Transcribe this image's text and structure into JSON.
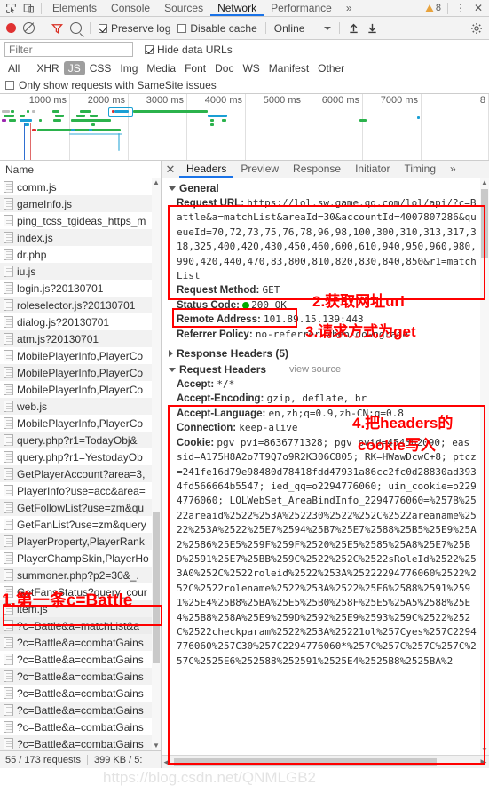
{
  "devtools": {
    "icons": [
      "inspect-element-icon",
      "device-toolbar-icon"
    ],
    "tabs": [
      {
        "label": "Elements",
        "active": false
      },
      {
        "label": "Console",
        "active": false
      },
      {
        "label": "Sources",
        "active": false
      },
      {
        "label": "Network",
        "active": true
      },
      {
        "label": "Performance",
        "active": false
      }
    ],
    "more_tabs": "»",
    "warning_count": "8",
    "menu_glyph": "⋮",
    "close_glyph": "✕"
  },
  "network_toolbar": {
    "record_title": "record-button",
    "clear_title": "clear-button",
    "filter_title": "filter-button",
    "search_title": "search-button",
    "preserve_log": "Preserve log",
    "preserve_log_checked": true,
    "disable_cache": "Disable cache",
    "disable_cache_checked": false,
    "throttle_value": "Online",
    "import_title": "import-har-button",
    "export_title": "export-har-button",
    "settings_title": "settings-gear"
  },
  "filter_bar": {
    "filter_placeholder": "Filter",
    "filter_value": "",
    "hide_data_urls": "Hide data URLs",
    "hide_data_urls_checked": true,
    "types": [
      {
        "label": "All",
        "selected": false
      },
      {
        "label": "XHR",
        "selected": false
      },
      {
        "label": "JS",
        "selected": true
      },
      {
        "label": "CSS",
        "selected": false
      },
      {
        "label": "Img",
        "selected": false
      },
      {
        "label": "Media",
        "selected": false
      },
      {
        "label": "Font",
        "selected": false
      },
      {
        "label": "Doc",
        "selected": false
      },
      {
        "label": "WS",
        "selected": false
      },
      {
        "label": "Manifest",
        "selected": false
      },
      {
        "label": "Other",
        "selected": false
      }
    ],
    "samesite_label": "Only show requests with SameSite issues",
    "samesite_checked": false
  },
  "overview": {
    "ticks": [
      "1000 ms",
      "2000 ms",
      "3000 ms",
      "4000 ms",
      "5000 ms",
      "6000 ms",
      "7000 ms",
      "8"
    ]
  },
  "request_list": {
    "column_header": "Name",
    "rows": [
      "comm.js",
      "gameInfo.js",
      "ping_tcss_tgideas_https_m",
      "index.js",
      "dr.php",
      "iu.js",
      "login.js?20130701",
      "roleselector.js?20130701",
      "dialog.js?20130701",
      "atm.js?20130701",
      "MobilePlayerInfo,PlayerCo",
      "MobilePlayerInfo,PlayerCo",
      "MobilePlayerInfo,PlayerCo",
      "web.js",
      "MobilePlayerInfo,PlayerCo",
      "query.php?r1=TodayObj&",
      "query.php?r1=YestodayOb",
      "GetPlayerAccount?area=3,",
      "PlayerInfo?use=acc&area=",
      "GetFollowList?use=zm&qu",
      "GetFanList?use=zm&query",
      "PlayerProperty,PlayerRank",
      "PlayerChampSkin,PlayerHo",
      "summoner.php?p2=30&_.",
      "GetFansStatus?query_cour",
      "item.js",
      "?c=Battle&a=matchList&a",
      "?c=Battle&a=combatGains",
      "?c=Battle&a=combatGains",
      "?c=Battle&a=combatGains",
      "?c=Battle&a=combatGains",
      "?c=Battle&a=combatGains",
      "?c=Battle&a=combatGains",
      "?c=Battle&a=combatGains",
      "?c=Battle&a=combatGains",
      "?c=Battle&a=combatGains"
    ],
    "selected_index": 26,
    "status_requests": "55 / 173 requests",
    "status_transferred": "399 KB / 5:"
  },
  "details": {
    "tabs": [
      {
        "label": "Headers",
        "active": true
      },
      {
        "label": "Preview",
        "active": false
      },
      {
        "label": "Response",
        "active": false
      },
      {
        "label": "Initiator",
        "active": false
      },
      {
        "label": "Timing",
        "active": false
      }
    ],
    "more_glyph": "»",
    "close_glyph": "✕",
    "general_title": "General",
    "general": [
      {
        "key": "Request URL:",
        "value": "https://lol.sw.game.qq.com/lol/api/?c=Battle&a=matchList&areaId=30&accountId=4007807286&queueId=70,72,73,75,76,78,96,98,100,300,310,313,317,318,325,400,420,430,450,460,600,610,940,950,960,980,990,420,440,470,83,800,810,820,830,840,850&r1=matchList"
      },
      {
        "key": "Request Method:",
        "value": "GET"
      },
      {
        "key": "Status Code:",
        "value": "200 OK",
        "dot": true
      },
      {
        "key": "Remote Address:",
        "value": "101.89.15.139:443"
      },
      {
        "key": "Referrer Policy:",
        "value": "no-referrer-when-downgrade"
      }
    ],
    "response_headers_title": "Response Headers (5)",
    "request_headers_title": "Request Headers",
    "view_source": "view source",
    "request_headers": [
      {
        "key": "Accept:",
        "value": "*/*"
      },
      {
        "key": "Accept-Encoding:",
        "value": "gzip, deflate, br"
      },
      {
        "key": "Accept-Language:",
        "value": "en,zh;q=0.9,zh-CN;q=0.8"
      },
      {
        "key": "Connection:",
        "value": "keep-alive"
      },
      {
        "key": "Cookie:",
        "value": "pgv_pvi=8636771328; pgv_pvid=454362090; eas_sid=A175H8A2o7T9Q7o9R2K306C805; RK=HWawDcwC+8; ptcz=241fe16d79e98480d78418fdd47931a86cc2fc0d28830ad3934fd566664b5547; ied_qq=o2294776060; uin_cookie=o2294776060; LOLWebSet_AreaBindInfo_2294776060=%257B%2522areaid%2522%253A%252230%2522%252C%2522areaname%2522%253A%2522%25E7%2594%25B7%25E7%2588%25B5%25E9%25A2%2586%25E5%259F%259F%2520%25E5%2585%25A8%25E7%25BD%2591%25E7%25BB%259C%2522%252C%2522sRoleId%2522%253A0%252C%2522roleid%2522%253A%25222294776060%2522%252C%2522rolename%2522%253A%2522%25E6%2588%2591%2591%25E4%25B8%25BA%25E5%25B0%258F%25E5%25A5%2588%25E4%25B8%258A%25E9%259D%2592%25E9%2593%259C%2522%252C%2522checkparam%2522%253A%25221ol%257Cyes%257C2294776060%257C30%257C2294776060*%257C%257C%257C%257C%257C%2525E6%252588%252591%2525E4%2525B8%2525BA%2"
      }
    ]
  },
  "annotations": [
    {
      "id": "anno-1",
      "text": "1.第一条c=Battle"
    },
    {
      "id": "anno-2",
      "text": "2.获取网址url"
    },
    {
      "id": "anno-3",
      "text": "3.请求方式为get"
    },
    {
      "id": "anno-4a",
      "text": "4.把headers的"
    },
    {
      "id": "anno-4b",
      "text": "cookie写入"
    }
  ],
  "watermark": "https://blog.csdn.net/QNMLGB2",
  "colors": {
    "accent": "#1a73e8",
    "record": "#e03131",
    "annotation": "#ff0000",
    "status_ok": "#00aa00",
    "toolbar_bg": "#f3f3f3"
  }
}
